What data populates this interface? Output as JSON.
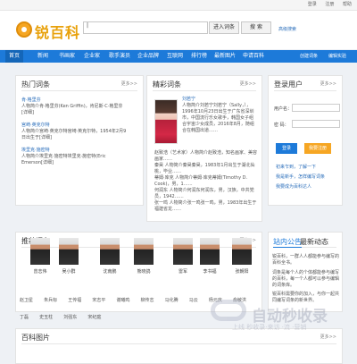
{
  "topbar": {
    "links": [
      "登录",
      "注册",
      "帮助"
    ]
  },
  "header": {
    "logo_text": "锐百科",
    "search_value": "|",
    "btn_entry": "进入词条",
    "btn_search": "搜 索",
    "advanced": "高级搜索"
  },
  "nav": {
    "items": [
      "首页",
      "新闻",
      "书画家",
      "企业家",
      "歌手演员",
      "企业品牌",
      "互联网",
      "排行榜",
      "最新图片",
      "申请百科"
    ],
    "right": [
      "创建词条",
      "编辑实验"
    ]
  },
  "hot": {
    "title": "热门词条",
    "more": "更多>>",
    "entries": [
      {
        "name": "肯·格里芬",
        "desc": "人物简介肯·格里芬(Ken Griffin)，肯尼斯·C·格里芬[详细]"
      },
      {
        "name": "宫崎·英克尔特",
        "desc": "人物简介宫崎·英克尔特宫崎·英克尔特，1954年2月9日出生于[详细]"
      },
      {
        "name": "埃里克·施密特",
        "desc": "人物简介埃里克·施密特埃里克·施密特(Eric Emerson[详细]"
      }
    ]
  },
  "featured": {
    "title": "精彩词条",
    "more": "更多>>",
    "name": "刘若宁",
    "desc": "人物简介刘若宁刘若宁（Sally，），1996年10月23日出生于广东省深圳市，中国流行乐女歌手，韩国女子组合宇宙少女成员，2016年8月，随组合在韩国出道……",
    "list": [
      "赵致浩（艺术家）人物简介赵致浩，知名画家、美容画家……",
      "秦昊  人物简介秦昊秦昊，1983年1月出生于湖北仙桃，毕业……",
      "蒂姆·库克  人物简介蒂姆·库克蒂姆(Timothy D. Cook)，男，1……",
      "何润东  人物简介何润东何润东，男，汉族，中共党员，1942……",
      "张一鸣  人物简介张一鸣张一鸣，男，1983年出生于福建省龙……"
    ]
  },
  "login": {
    "title": "登录用户",
    "more": "更多>>",
    "username_label": "用户名：",
    "password_label": "密  码：",
    "login_btn": "登录",
    "register_btn": "我要注册",
    "tips": [
      "初来乍到，了解一下",
      "我是新手，怎样编写词条",
      "我要成为百科达人"
    ]
  },
  "recommend": {
    "title": "推荐词条",
    "more": "更多>>",
    "people": [
      "曾志伟",
      "吴小群",
      "沈南鹏",
      "熊晓鸽",
      "雷军",
      "李书福",
      "张朝阳"
    ],
    "links": [
      "赵卫星",
      "朱兵标",
      "王传福",
      "宋志平",
      "谢曦鸣",
      "柳传志",
      "马化腾",
      "马云",
      "杨元庆",
      "俞敏洪",
      "丁磊",
      "史玉柱",
      "刘强东",
      "宋纪庭"
    ]
  },
  "notice": {
    "tab1": "站内公告",
    "tab2": "最新动态",
    "items": [
      "锐百科，一群人人都能参与编写的百科全书。",
      "词条是每个人的个体都能参与编写的百科，每一个人都可以参与编辑的词条库。",
      "锐百科需要你的加入，与你一起共同编写词条的新世界。"
    ]
  },
  "gallery": {
    "title": "百科图片",
    "more": "更多>>"
  },
  "watermark": {
    "main": "自动秒收录",
    "sub": "上线 秒收录·来访 ·流 ·营销"
  }
}
